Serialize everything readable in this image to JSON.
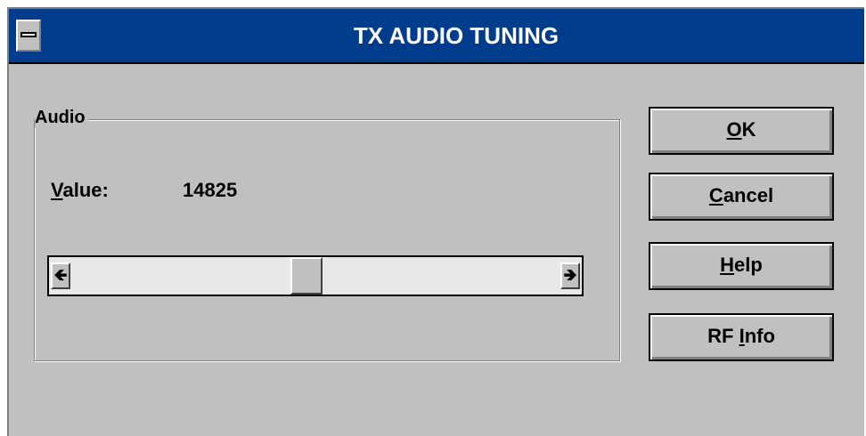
{
  "window": {
    "title": "TX AUDIO TUNING"
  },
  "audio_group": {
    "legend": "Audio",
    "value_label_mnemonic": "V",
    "value_label_rest": "alue:",
    "value": "14825",
    "slider_level": 0.48
  },
  "buttons": {
    "ok_mnemonic": "O",
    "ok_rest": "K",
    "cancel_mnemonic": "C",
    "cancel_rest": "ancel",
    "help_mnemonic": "H",
    "help_rest": "elp",
    "rfinfo_prefix": "RF ",
    "rfinfo_mnemonic": "I",
    "rfinfo_rest": "nfo"
  },
  "icons": {
    "system_menu": "system-menu-icon",
    "scroll_left": "left-arrow-icon",
    "scroll_right": "right-arrow-icon"
  },
  "colors": {
    "titlebar": "#003c8c",
    "face": "#c0c0c0",
    "track": "#e8e8e8"
  }
}
